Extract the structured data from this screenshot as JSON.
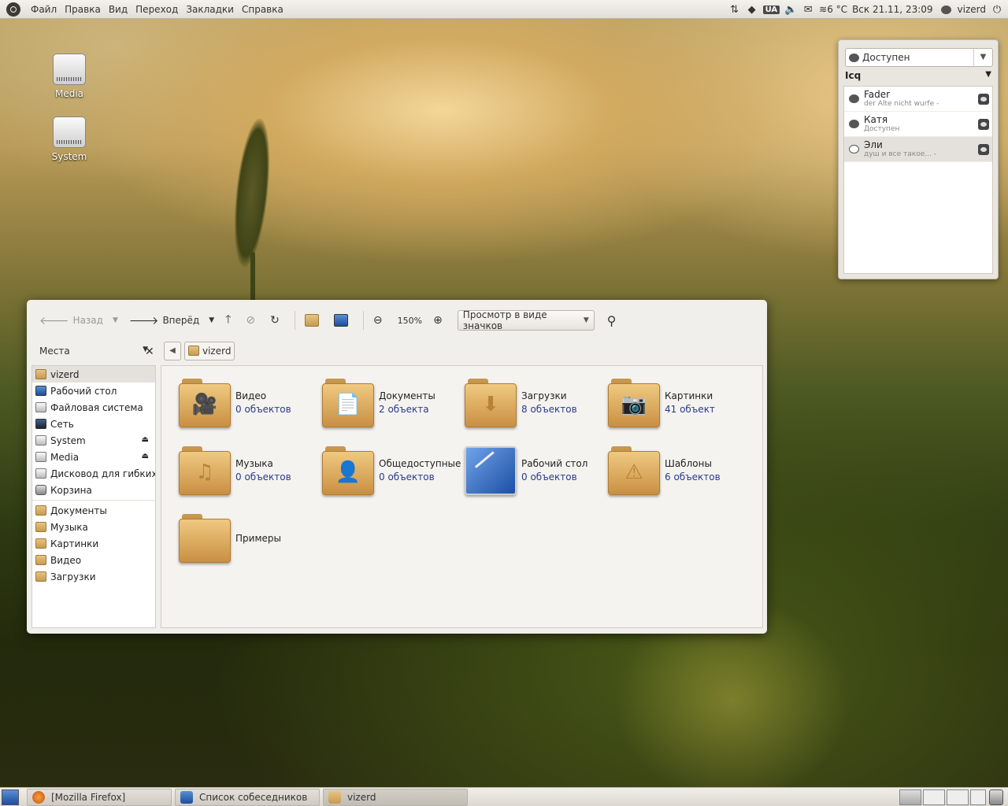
{
  "top_panel": {
    "menu": [
      "Файл",
      "Правка",
      "Вид",
      "Переход",
      "Закладки",
      "Справка"
    ],
    "keyboard_layout": "UA",
    "weather": "6 °C",
    "datetime": "Вск 21.11, 23:09",
    "user": "vizerd"
  },
  "desktop": {
    "icons": [
      {
        "label": "Media"
      },
      {
        "label": "System"
      }
    ]
  },
  "chat": {
    "status": "Доступен",
    "group": "Icq",
    "contacts": [
      {
        "name": "Fader",
        "status": "der Alte nicht wurfe -"
      },
      {
        "name": "Катя",
        "status": "Доступен"
      },
      {
        "name": "Эли",
        "status": "душ и все такое... -"
      }
    ]
  },
  "file_manager": {
    "toolbar": {
      "back": "Назад",
      "forward": "Вперёд",
      "zoom": "150%",
      "view": "Просмотр в виде значков"
    },
    "sidebar_title": "Места",
    "path": "vizerd",
    "places": [
      "vizerd",
      "Рабочий стол",
      "Файловая система",
      "Сеть",
      "System",
      "Media",
      "Дисковод для гибких...",
      "Корзина"
    ],
    "bookmarks": [
      "Документы",
      "Музыка",
      "Картинки",
      "Видео",
      "Загрузки"
    ],
    "items": [
      {
        "name": "Видео",
        "info": "0 объектов"
      },
      {
        "name": "Документы",
        "info": "2 объекта"
      },
      {
        "name": "Загрузки",
        "info": "8 объектов"
      },
      {
        "name": "Картинки",
        "info": "41 объект"
      },
      {
        "name": "Музыка",
        "info": "0 объектов"
      },
      {
        "name": "Общедоступные",
        "info": "0 объектов"
      },
      {
        "name": "Рабочий стол",
        "info": "0 объектов"
      },
      {
        "name": "Шаблоны",
        "info": "6 объектов"
      },
      {
        "name": "Примеры",
        "info": ""
      }
    ]
  },
  "taskbar": {
    "tasks": [
      "[Mozilla Firefox]",
      "Список собеседников",
      "vizerd"
    ]
  }
}
